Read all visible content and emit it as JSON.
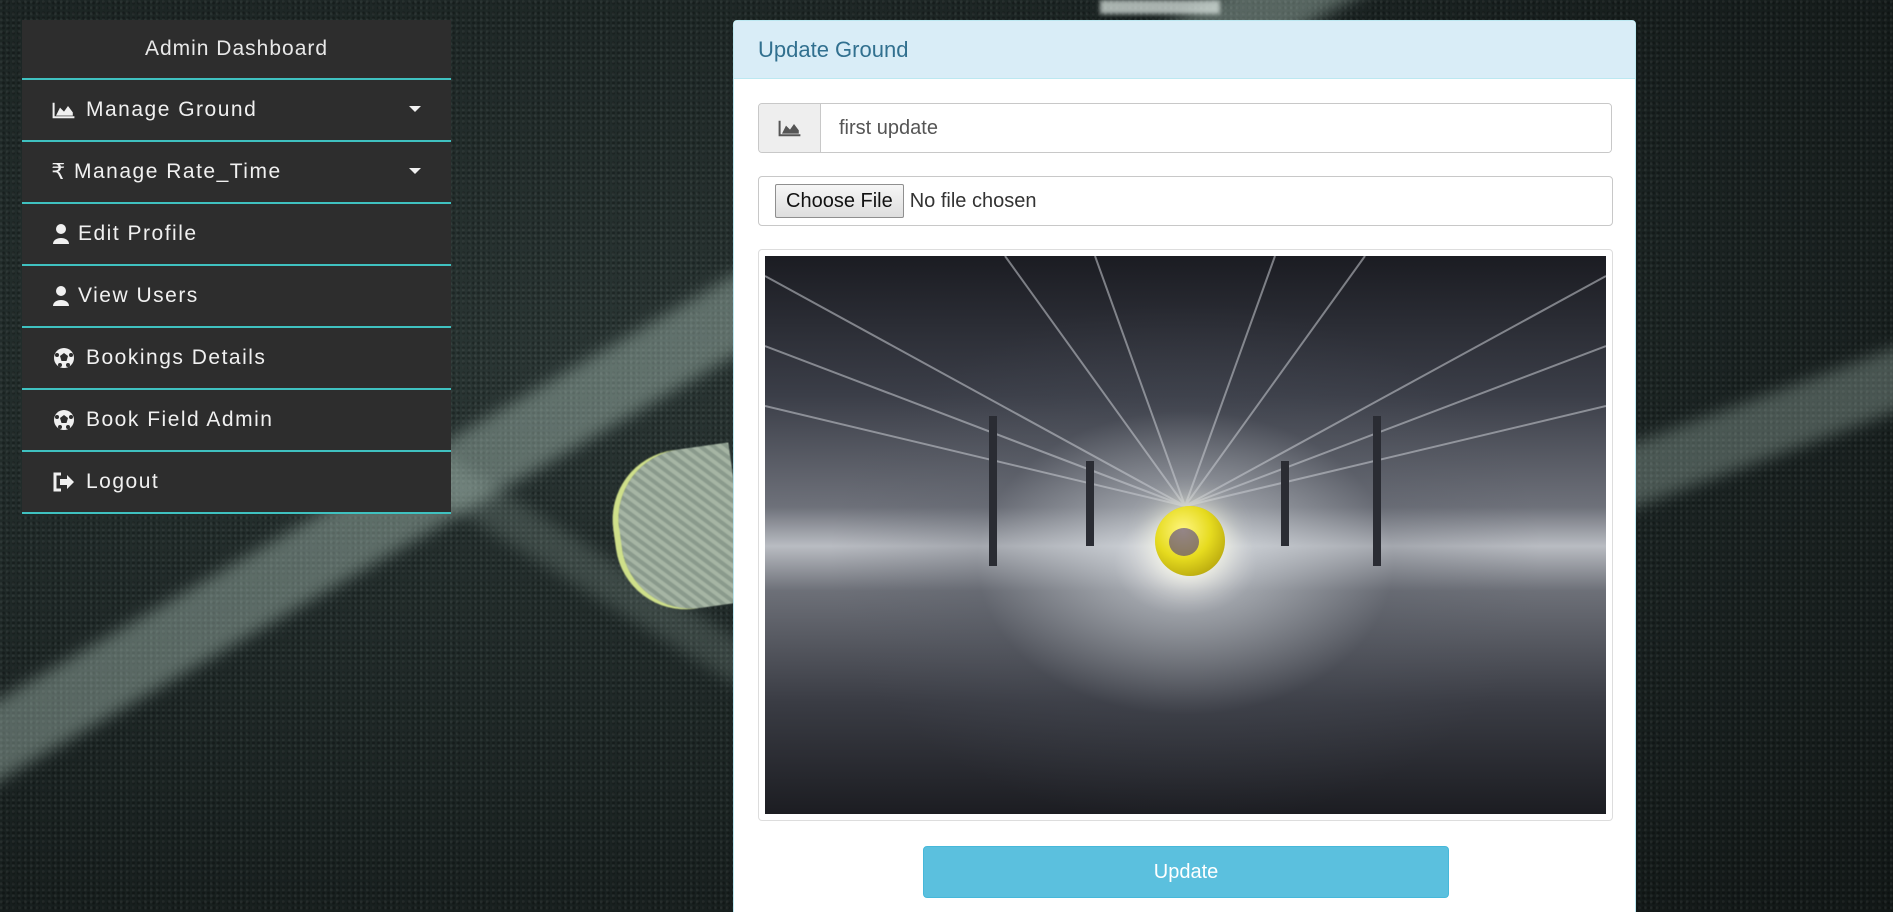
{
  "sidebar": {
    "title": "Admin Dashboard",
    "items": [
      {
        "label": "Manage Ground",
        "icon": "area-chart-icon",
        "has_dropdown": true
      },
      {
        "label": "Manage Rate_Time",
        "icon": "rupee-icon",
        "has_dropdown": true
      },
      {
        "label": "Edit Profile",
        "icon": "user-icon",
        "has_dropdown": false
      },
      {
        "label": "View Users",
        "icon": "user-icon",
        "has_dropdown": false
      },
      {
        "label": "Bookings Details",
        "icon": "soccer-ball-icon",
        "has_dropdown": false
      },
      {
        "label": "Book Field Admin",
        "icon": "soccer-ball-icon",
        "has_dropdown": false
      },
      {
        "label": "Logout",
        "icon": "sign-out-icon",
        "has_dropdown": false
      }
    ]
  },
  "panel": {
    "heading": "Update Ground",
    "ground_name": {
      "value": "first update",
      "icon": "area-chart-icon"
    },
    "file": {
      "button_label": "Choose File",
      "status": "No file chosen"
    },
    "image_alt": "ground-image",
    "submit_label": "Update"
  },
  "colors": {
    "sidebar_bg": "#2d2d2d",
    "sidebar_accent": "#3fc1c0",
    "panel_header_bg": "#d9edf7",
    "panel_header_text": "#31708f",
    "button_info": "#5bc0de"
  }
}
